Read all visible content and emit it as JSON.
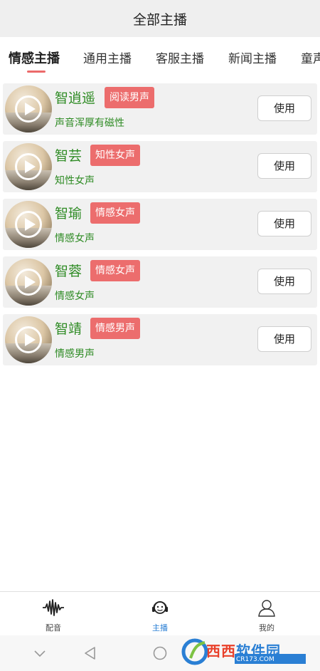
{
  "header": {
    "title": "全部主播"
  },
  "tabs": [
    {
      "label": "情感主播",
      "active": true
    },
    {
      "label": "通用主播",
      "active": false
    },
    {
      "label": "客服主播",
      "active": false
    },
    {
      "label": "新闻主播",
      "active": false
    },
    {
      "label": "童声",
      "active": false
    }
  ],
  "anchors": [
    {
      "name": "智逍遥",
      "tag": "阅读男声",
      "desc": "声音浑厚有磁性",
      "action": "使用"
    },
    {
      "name": "智芸",
      "tag": "知性女声",
      "desc": "知性女声",
      "action": "使用"
    },
    {
      "name": "智瑜",
      "tag": "情感女声",
      "desc": "情感女声",
      "action": "使用"
    },
    {
      "name": "智蓉",
      "tag": "情感女声",
      "desc": "情感女声",
      "action": "使用"
    },
    {
      "name": "智靖",
      "tag": "情感男声",
      "desc": "情感男声",
      "action": "使用"
    }
  ],
  "bottom_nav": [
    {
      "label": "配音",
      "icon": "waveform-icon",
      "active": false
    },
    {
      "label": "主播",
      "icon": "headset-icon",
      "active": true
    },
    {
      "label": "我的",
      "icon": "user-icon",
      "active": false
    }
  ],
  "system_nav": [
    "chevron-down-icon",
    "back-triangle-icon",
    "home-circle-icon"
  ],
  "watermark": {
    "text_red": "西西",
    "text_blue": "软件园",
    "url": "CR173.COM"
  },
  "colors": {
    "accent_red": "#ec6d6d",
    "name_green": "#2e8b24",
    "active_blue": "#2a7fd4"
  }
}
